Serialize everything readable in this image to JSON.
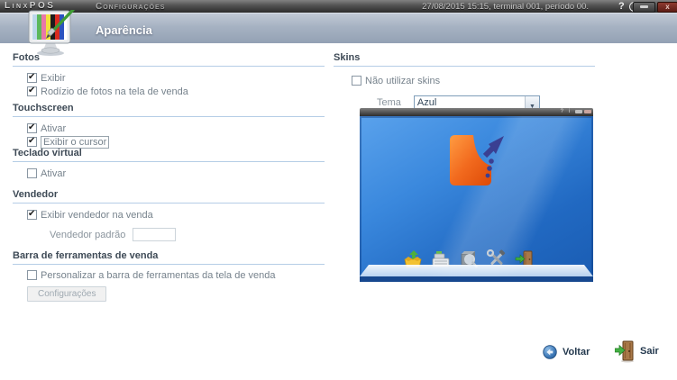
{
  "header": {
    "logo": "LinxPOS",
    "window_title": "Configurações",
    "status_text": "27/08/2015 15:15, terminal 001, período 00.",
    "help_label": "?",
    "info_label": "i",
    "close_label": "x"
  },
  "page": {
    "title": "Aparência",
    "icon": "monitor-paintbrush-icon"
  },
  "fotos": {
    "title": "Fotos",
    "exibir": {
      "label": "Exibir",
      "checked": true
    },
    "rodizio": {
      "label": "Rodízio de fotos na tela de venda",
      "checked": true
    }
  },
  "touchscreen": {
    "title": "Touchscreen",
    "ativar": {
      "label": "Ativar",
      "checked": true
    },
    "cursor": {
      "label": "Exibir o cursor",
      "checked": true,
      "focused": true
    }
  },
  "teclado": {
    "title": "Teclado virtual",
    "ativar": {
      "label": "Ativar",
      "checked": false
    }
  },
  "vendedor": {
    "title": "Vendedor",
    "exibir": {
      "label": "Exibir vendedor na venda",
      "checked": true
    },
    "padrao_label": "Vendedor padrão",
    "padrao_value": ""
  },
  "barra": {
    "title": "Barra de ferramentas de venda",
    "personalizar": {
      "label": "Personalizar a barra de ferramentas da tela de venda",
      "checked": false
    },
    "config_button": "Configurações"
  },
  "skins": {
    "title": "Skins",
    "nao_utilizar": {
      "label": "Não utilizar skins",
      "checked": false
    },
    "tema_label": "Tema",
    "tema_value": "Azul"
  },
  "preview": {
    "titlebar_glyphs": "? i",
    "icon_names": [
      "open-box-icon",
      "cash-register-icon",
      "search-cube-icon",
      "tools-icon",
      "exit-door-icon"
    ],
    "theme_blue": "#2a7fd4",
    "logo_orange": "#f26a1e",
    "logo_navy": "#3a3f92"
  },
  "footer": {
    "voltar": "Voltar",
    "sair": "Sair"
  }
}
